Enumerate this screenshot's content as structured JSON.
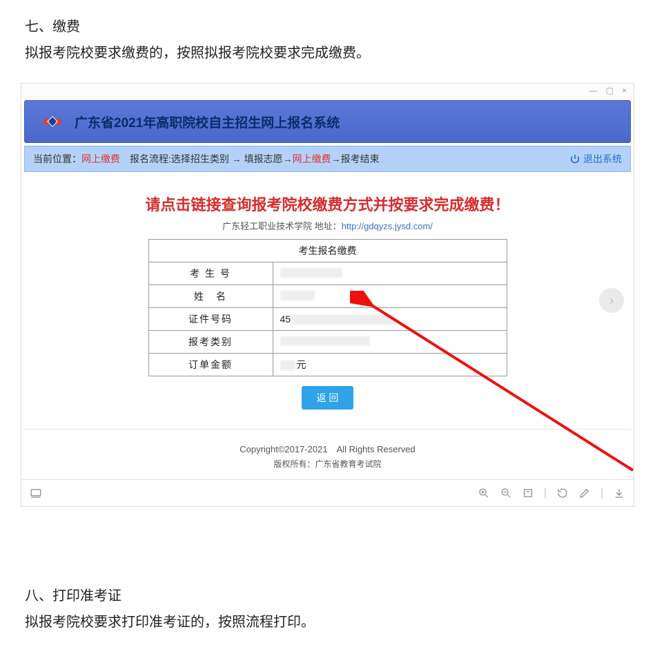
{
  "section7": {
    "heading": "七、缴费",
    "body": "拟报考院校要求缴费的，按照拟报考院校要求完成缴费。"
  },
  "window": {
    "title": "广东省2021年高职院校自主招生网上报名系统",
    "breadcrumb": {
      "label": "当前位置：",
      "current": "网上缴费",
      "flow_prefix": "　报名流程:选择招生类别 → 填报志愿→",
      "flow_hl": "网上缴费",
      "flow_suffix": " →报考结束"
    },
    "logout": "退出系统",
    "notice": "请点击链接查询报考院校缴费方式并按要求完成缴费！",
    "sub_notice_school": "广东轻工职业技术学院 地址：",
    "sub_notice_url": "http://gdqyzs.jysd.com/",
    "table": {
      "header": "考生报名缴费",
      "rows": [
        {
          "label": "考 生 号",
          "value": ""
        },
        {
          "label": "姓　名",
          "value": ""
        },
        {
          "label": "证件号码",
          "value": "45"
        },
        {
          "label": "报考类别",
          "value": ""
        },
        {
          "label": "订单金额",
          "value": "元"
        }
      ]
    },
    "return_btn": "返 回",
    "footer1": "Copyright©2017-2021　All Rights Reserved",
    "footer2": "版权所有：广东省教育考试院"
  },
  "section8": {
    "heading": "八、打印准考证",
    "body": "拟报考院校要求打印准考证的，按照流程打印。"
  }
}
